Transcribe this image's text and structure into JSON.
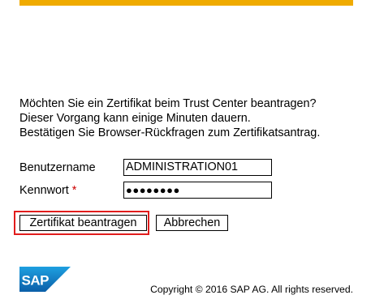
{
  "header": {
    "accent_color": "#f0ab00"
  },
  "message": {
    "line1": "Möchten Sie ein Zertifikat beim Trust Center beantragen?",
    "line2": "Dieser Vorgang kann einige Minuten dauern.",
    "line3": "Bestätigen Sie Browser-Rückfragen zum Zertifikatsantrag."
  },
  "form": {
    "username_label": "Benutzername",
    "username_value": "ADMINISTRATION01",
    "password_label": "Kennwort",
    "password_required_marker": "*",
    "password_value": "●●●●●●●●"
  },
  "buttons": {
    "request_label": "Zertifikat beantragen",
    "cancel_label": "Abbrechen"
  },
  "highlight_color": "#e11c1c",
  "footer": {
    "logo_text": "SAP",
    "copyright": "Copyright © 2016 SAP AG. All rights reserved."
  }
}
